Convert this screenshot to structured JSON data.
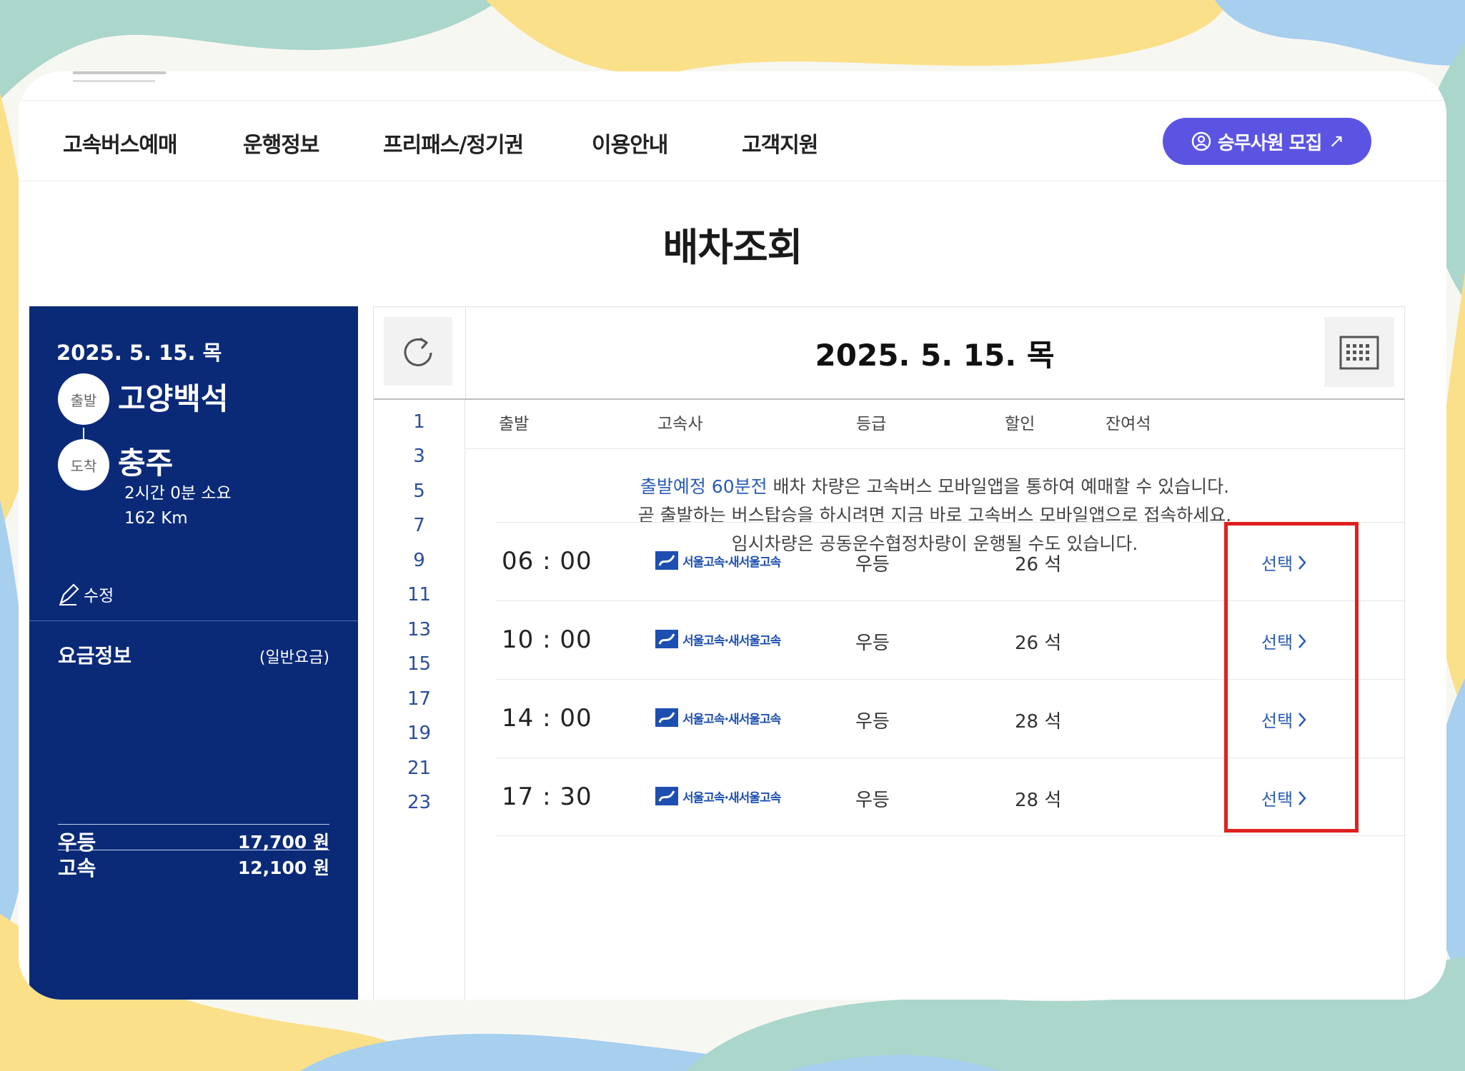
{
  "colors": {
    "panel_navy": "#0a2a78",
    "accent_purple": "#5b54e2",
    "link_blue": "#2a5bb8",
    "highlight_red": "#e02020"
  },
  "nav": {
    "items": [
      "고속버스예매",
      "운행정보",
      "프리패스/정기권",
      "이용안내",
      "고객지원"
    ],
    "recruit_button": "승무사원 모집",
    "recruit_arrow": "↗"
  },
  "page_title": "배차조회",
  "left_panel": {
    "date": "2025. 5. 15. 목",
    "departure_badge": "출발",
    "departure_station": "고양백석",
    "arrival_badge": "도착",
    "arrival_station": "충주",
    "duration": "2시간 0분 소요",
    "distance": "162 Km",
    "edit_label": "수정",
    "fare_title": "요금정보",
    "fare_note": "(일반요금)",
    "fares": [
      {
        "grade": "우등",
        "price": "17,700 원"
      },
      {
        "grade": "고속",
        "price": "12,100 원"
      }
    ]
  },
  "right_panel": {
    "date": "2025. 5. 15. 목",
    "hours": [
      "1",
      "3",
      "5",
      "7",
      "9",
      "11",
      "13",
      "15",
      "17",
      "19",
      "21",
      "23"
    ],
    "columns": [
      "출발",
      "고속사",
      "등급",
      "할인",
      "잔여석"
    ],
    "notice": {
      "line1_highlight": "출발예정 60분전",
      "line1_rest": " 배차 차량은 고속버스 모바일앱을 통하여 예매할 수 있습니다.",
      "line2": "곧 출발하는 버스탑승을 하시려면 지금 바로 고속버스 모바일앱으로 접속하세요.",
      "line3": "임시차량은 공동운수협정차량이 운행될 수도 있습니다."
    },
    "schedules": [
      {
        "time": "06 : 00",
        "company": "서울고속·새서울고속",
        "grade": "우등",
        "seats": "26 석",
        "select": "선택"
      },
      {
        "time": "10 : 00",
        "company": "서울고속·새서울고속",
        "grade": "우등",
        "seats": "26 석",
        "select": "선택"
      },
      {
        "time": "14 : 00",
        "company": "서울고속·새서울고속",
        "grade": "우등",
        "seats": "28 석",
        "select": "선택"
      },
      {
        "time": "17 : 30",
        "company": "서울고속·새서울고속",
        "grade": "우등",
        "seats": "28 석",
        "select": "선택"
      }
    ]
  }
}
